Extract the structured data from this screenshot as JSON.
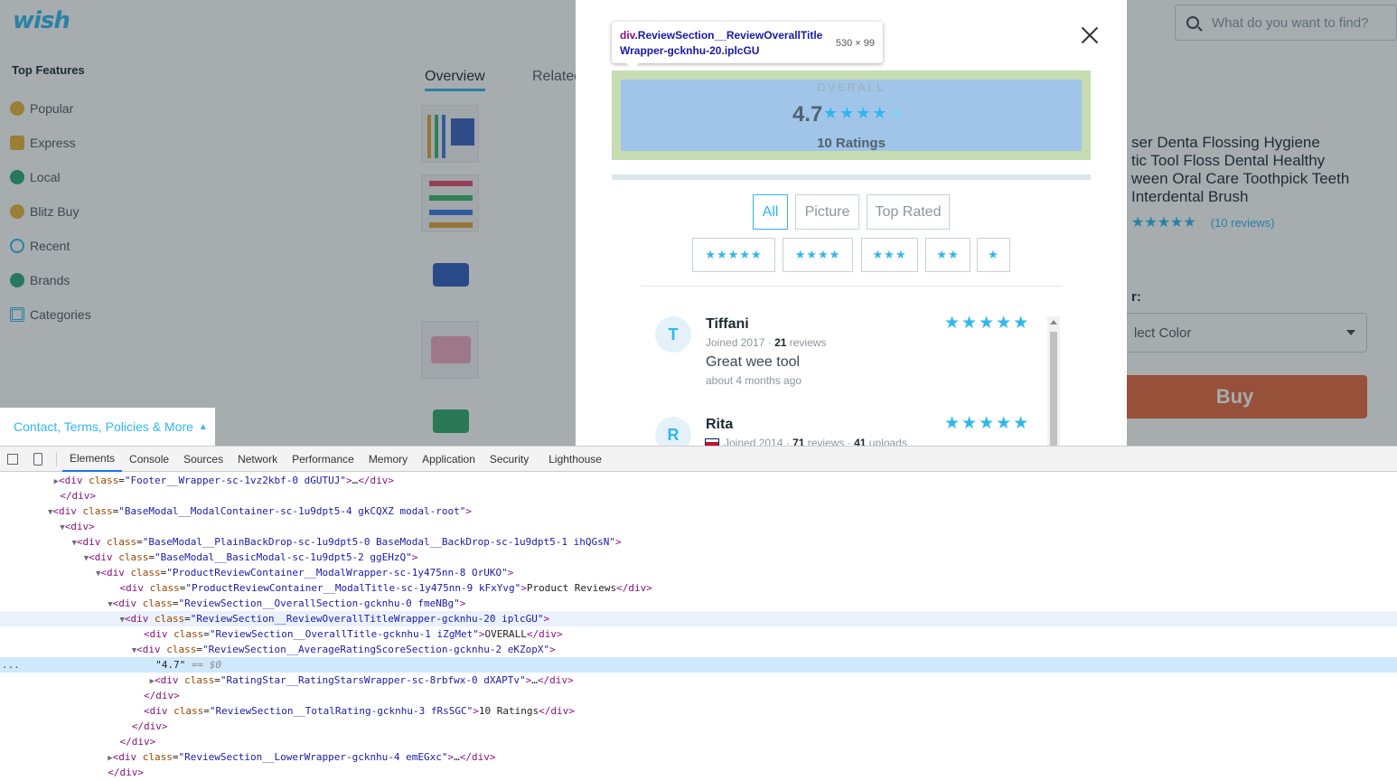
{
  "site": {
    "logo": "wish",
    "search_placeholder": "What do you want to find?",
    "sidebar_title": "Top Features",
    "sidebar_items": [
      {
        "label": "Popular",
        "icon": "star-icon",
        "color": "#e8b43a"
      },
      {
        "label": "Express",
        "icon": "truck-icon",
        "color": "#e8b43a"
      },
      {
        "label": "Local",
        "icon": "location-pin-icon",
        "color": "#2aa876"
      },
      {
        "label": "Blitz Buy",
        "icon": "coin-icon",
        "color": "#e8b43a"
      },
      {
        "label": "Recent",
        "icon": "clock-icon",
        "color": "#2fb7ec"
      },
      {
        "label": "Brands",
        "icon": "verified-shield-icon",
        "color": "#2aa876"
      },
      {
        "label": "Categories",
        "icon": "grid-icon",
        "color": "#2fb7ec"
      }
    ],
    "tabs": [
      "Overview",
      "Related"
    ],
    "product_title": "ser Denta Flossing Hygiene\ntic Tool Floss Dental Healthy\nween Oral Care Toothpick Teeth\n Interdental Brush",
    "product_reviews": "(10 reviews)",
    "color_label": "r:",
    "color_select": "lect Color",
    "buy_label": "Buy",
    "footer_link": "Contact, Terms, Policies & More"
  },
  "modal": {
    "overall_title": "OVERALL",
    "average_score": "4.7",
    "total_ratings": "10 Ratings",
    "filters": [
      "All",
      "Picture",
      "Top Rated"
    ],
    "active_filter": "All",
    "star_filters": [
      "★★★★★",
      "★★★★",
      "★★★",
      "★★",
      "★"
    ],
    "reviews": [
      {
        "initial": "T",
        "name": "Tiffani",
        "joined": "Joined 2017 · ",
        "reviews_count": "21",
        "reviews_word": " reviews",
        "uploads_count": "",
        "uploads_word": "",
        "text": "Great wee tool",
        "time": "about 4 months ago",
        "stars": "★★★★★"
      },
      {
        "initial": "R",
        "name": "Rita",
        "joined": "Joined 2014 · ",
        "reviews_count": "71",
        "reviews_word": " reviews · ",
        "uploads_count": "41",
        "uploads_word": " uploads",
        "text": "",
        "time": "",
        "stars": "★★★★★"
      }
    ]
  },
  "tooltip": {
    "tag": "div",
    "class_text": ".ReviewSection__ReviewOverallTitleWrapper-gcknhu-20.iplcGU",
    "size": "530 × 99"
  },
  "devtools": {
    "tabs": [
      "Elements",
      "Console",
      "Sources",
      "Network",
      "Performance",
      "Memory",
      "Application",
      "Security",
      "Lighthouse"
    ],
    "active_tab": "Elements",
    "selected_marker": "...",
    "selected_suffix": " == $0"
  },
  "colors": {
    "accent": "#2fb7ec",
    "buy": "#e4673b",
    "highlight_content": "#a1c5e9",
    "highlight_padding": "#c6dcb1"
  }
}
